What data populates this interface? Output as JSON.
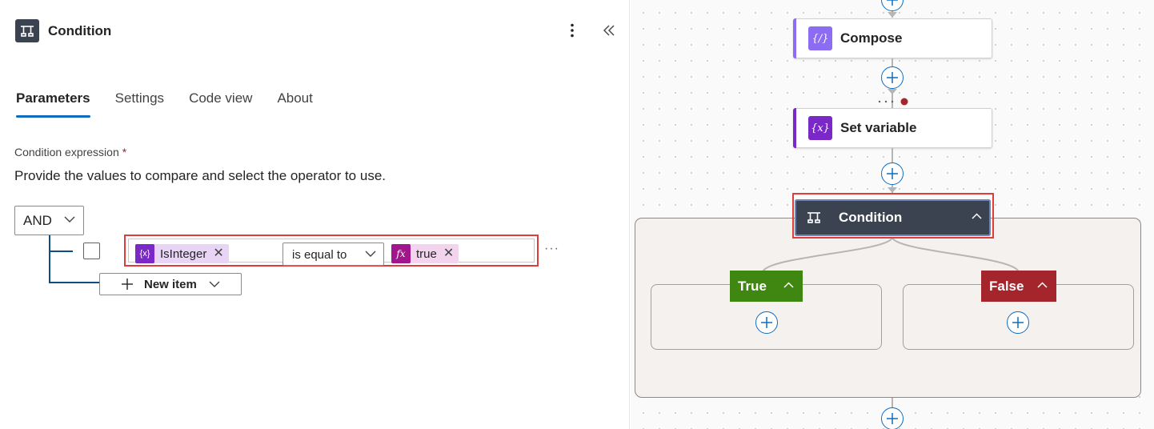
{
  "panel": {
    "title": "Condition",
    "tabs": [
      {
        "label": "Parameters",
        "active": true
      },
      {
        "label": "Settings",
        "active": false
      },
      {
        "label": "Code view",
        "active": false
      },
      {
        "label": "About",
        "active": false
      }
    ],
    "field_label": "Condition expression",
    "required_mark": "*",
    "field_description": "Provide the values to compare and select the operator to use.",
    "group_operator": "AND",
    "row": {
      "left_token": {
        "icon": "{x}",
        "label": "IsInteger"
      },
      "operator": "is equal to",
      "right_token": {
        "icon": "fx",
        "label": "true"
      }
    },
    "row_more": "···",
    "new_item_label": "New item"
  },
  "canvas": {
    "compose_title": "Compose",
    "compose_icon": "{/}",
    "setvar_title": "Set variable",
    "setvar_icon": "{x}",
    "condition_title": "Condition",
    "true_label": "True",
    "false_label": "False"
  },
  "colors": {
    "accent_blue": "#0f6cbd",
    "variable_purple": "#7a28c8",
    "compose_purple": "#8c6cf2",
    "condition_dark": "#3b4250",
    "true_green": "#3f8711",
    "false_red": "#a4262c",
    "highlight_red": "#e03c3c"
  }
}
